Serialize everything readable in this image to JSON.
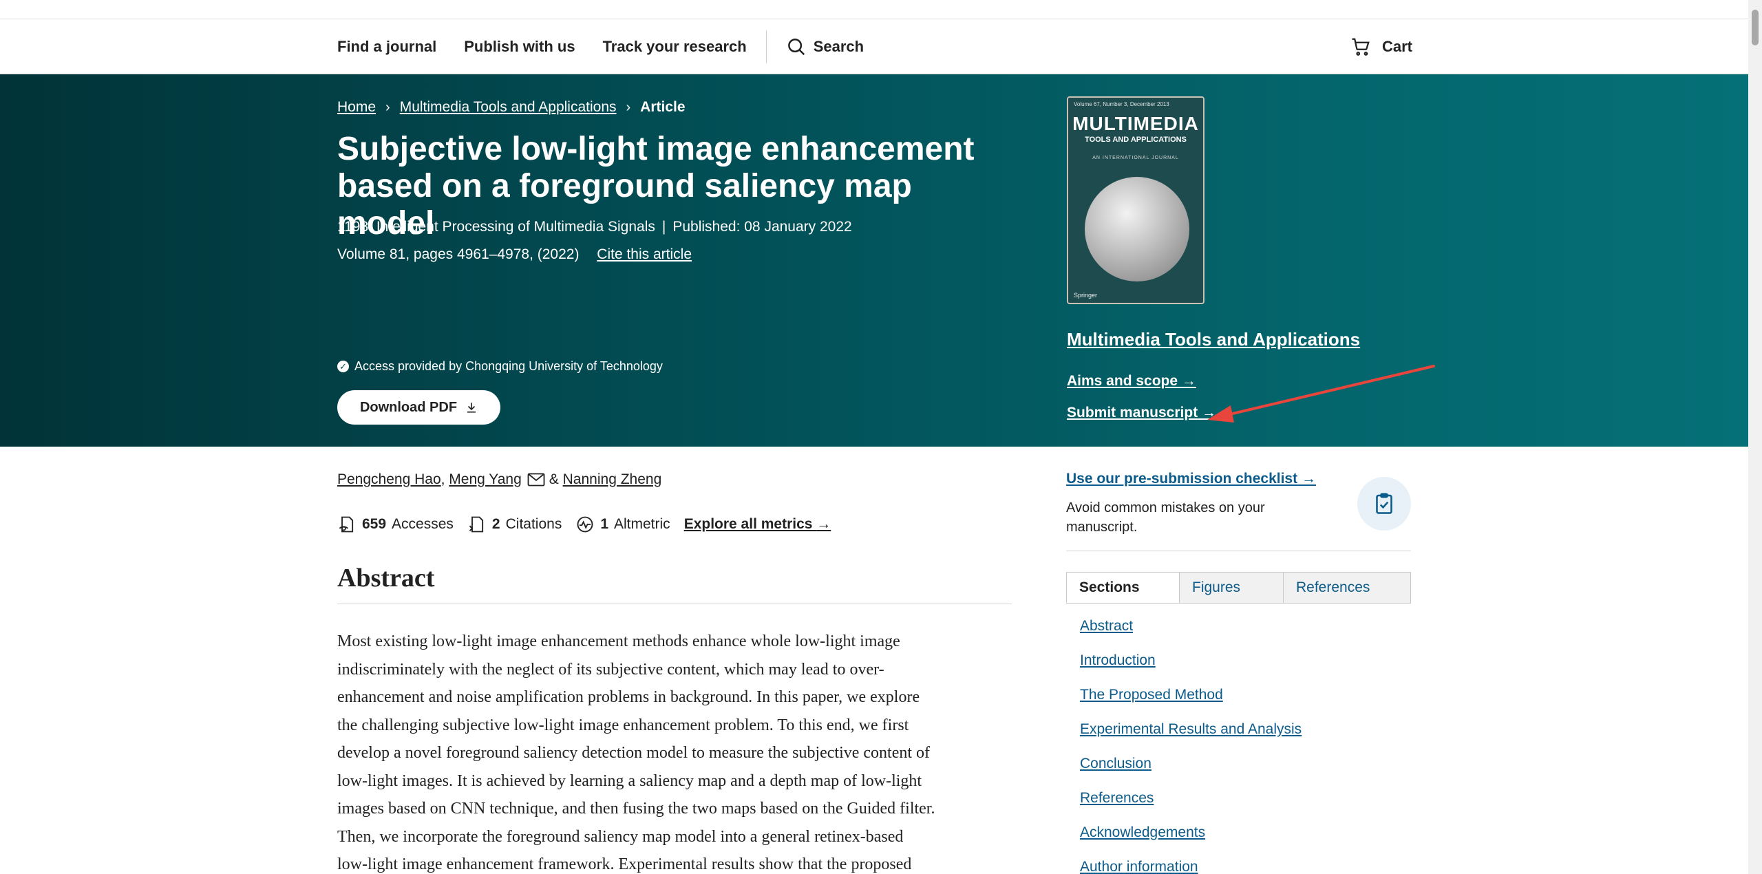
{
  "nav": {
    "items": [
      "Find a journal",
      "Publish with us",
      "Track your research"
    ],
    "search_label": "Search",
    "cart_label": "Cart"
  },
  "breadcrumb": {
    "home": "Home",
    "journal": "Multimedia Tools and Applications",
    "current": "Article"
  },
  "article": {
    "title": "Subjective low-light image enhancement based on a foreground saliency map model",
    "collection": "1193: Intelligent Processing of Multimedia Signals",
    "published": "Published: 08 January 2022",
    "volume": "Volume 81, pages 4961–4978, (2022)",
    "cite_label": "Cite this article",
    "access": "Access provided by Chongqing University of Technology",
    "download_label": "Download PDF"
  },
  "journal_panel": {
    "cover_vol": "Volume 67, Number 3, December 2013",
    "cover_title": "MULTIMEDIA",
    "cover_sub": "TOOLS AND APPLICATIONS",
    "cover_tag": "AN INTERNATIONAL JOURNAL",
    "cover_pub": "Springer",
    "journal_name": "Multimedia Tools and Applications",
    "aims_label": "Aims and scope",
    "submit_label": "Submit manuscript"
  },
  "authors": {
    "a1": "Pengcheng Hao",
    "a2": "Meng Yang",
    "amp": "&",
    "a3": "Nanning Zheng"
  },
  "metrics": {
    "accesses_value": "659",
    "accesses_label": "Accesses",
    "citations_value": "2",
    "citations_label": "Citations",
    "altmetric_value": "1",
    "altmetric_label": "Altmetric",
    "explore_label": "Explore all metrics"
  },
  "abstract": {
    "heading": "Abstract",
    "lines": [
      "Most existing low-light image enhancement methods enhance whole low-light image",
      "indiscriminately with the neglect of its subjective content, which may lead to over-",
      "enhancement and noise amplification problems in background. In this paper, we explore",
      "the challenging subjective low-light image enhancement problem. To this end, we first",
      "develop a novel foreground saliency detection model to measure the subjective content of",
      "low-light images. It is achieved by learning a saliency map and a depth map of low-light",
      "images based on CNN technique, and then fusing the two maps based on the Guided filter.",
      "Then, we incorporate the foreground saliency map model into a general retinex-based",
      "low-light image enhancement framework. Experimental results show that the proposed"
    ]
  },
  "sidebar": {
    "checklist_label": "Use our pre-submission checklist",
    "checklist_desc": "Avoid common mistakes on your manuscript.",
    "tabs": [
      "Sections",
      "Figures",
      "References"
    ],
    "sections": [
      "Abstract",
      "Introduction",
      "The Proposed Method",
      "Experimental Results and Analysis",
      "Conclusion",
      "References",
      "Acknowledgements",
      "Author information"
    ]
  },
  "colors": {
    "hero_dark": "#013338",
    "hero_light": "#057077",
    "link_blue": "#0c5b8a",
    "annotation_red": "#e8453c"
  }
}
